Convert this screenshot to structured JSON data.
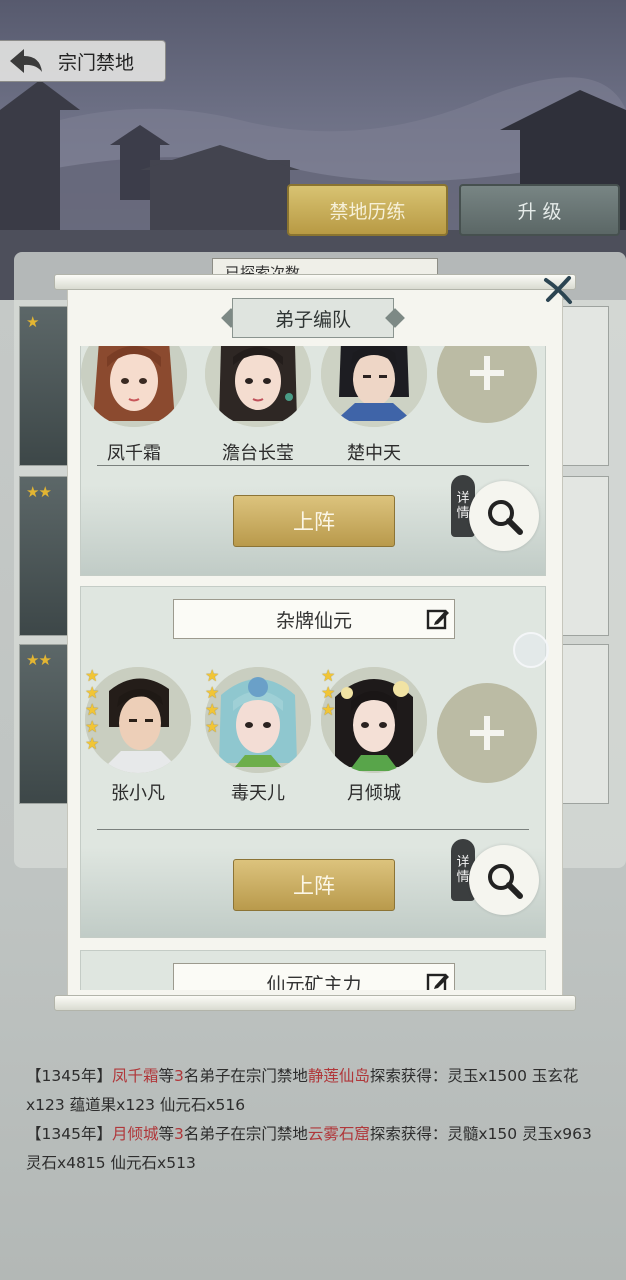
{
  "header": {
    "title": "宗门禁地"
  },
  "tabs": [
    {
      "label": "禁地历练",
      "active": true
    },
    {
      "label": "升 级",
      "active": false
    }
  ],
  "explore_count_label": "已探索次数",
  "dialog": {
    "title": "弟子编队",
    "teams": [
      {
        "members": [
          {
            "name": "凤千霜",
            "stars": 0
          },
          {
            "name": "澹台长莹",
            "stars": 0
          },
          {
            "name": "楚中天",
            "stars": 0
          }
        ],
        "deploy_label": "上阵",
        "detail_label": [
          "详",
          "情"
        ]
      },
      {
        "name": "杂牌仙元",
        "members": [
          {
            "name": "张小凡",
            "stars": 5
          },
          {
            "name": "毒天儿",
            "stars": 4
          },
          {
            "name": "月倾城",
            "stars": 3
          }
        ],
        "deploy_label": "上阵",
        "detail_label": [
          "详",
          "情"
        ]
      },
      {
        "name": "仙元矿主力"
      }
    ]
  },
  "log": [
    {
      "year": "【1345年】",
      "leader": "凤千霜",
      "mid1": "等",
      "count": "3",
      "mid2": "名弟子在宗门禁地",
      "place": "静莲仙岛",
      "rest": "探索获得：灵玉x1500 玉玄花x123 蕴道果x123 仙元石x516"
    },
    {
      "year": "【1345年】",
      "leader": "月倾城",
      "mid1": "等",
      "count": "3",
      "mid2": "名弟子在宗门禁地",
      "place": "云雾石窟",
      "rest": "探索获得：灵髓x150 灵玉x963 灵石x4815 仙元石x513"
    }
  ],
  "colors": {
    "accent_gold": "#c9ad5c",
    "highlight_red": "#b0373a",
    "panel_green": "#dfe6e0"
  }
}
